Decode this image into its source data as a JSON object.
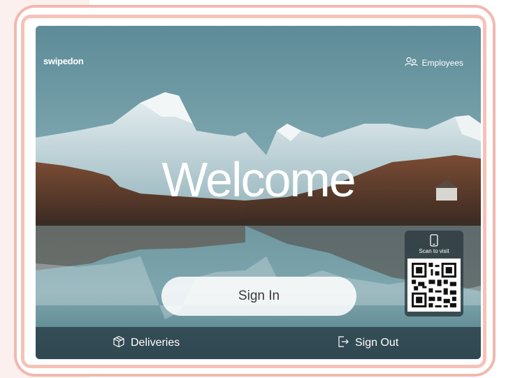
{
  "brand": {
    "logo_text": "swipedon"
  },
  "header": {
    "employees_label": "Employees",
    "employees_icon": "users-icon"
  },
  "main": {
    "welcome_text": "Welcome",
    "sign_in_label": "Sign In"
  },
  "qr_panel": {
    "label": "Scan to visit",
    "phone_icon": "phone-icon",
    "qr_icon": "qr-code-icon"
  },
  "footer": {
    "deliveries_label": "Deliveries",
    "deliveries_icon": "package-icon",
    "sign_out_label": "Sign Out",
    "sign_out_icon": "sign-out-icon"
  },
  "colors": {
    "frame": "#f2b8ae",
    "sky": "#5e8e99",
    "footer": "#263a42",
    "button": "#ffffff"
  }
}
